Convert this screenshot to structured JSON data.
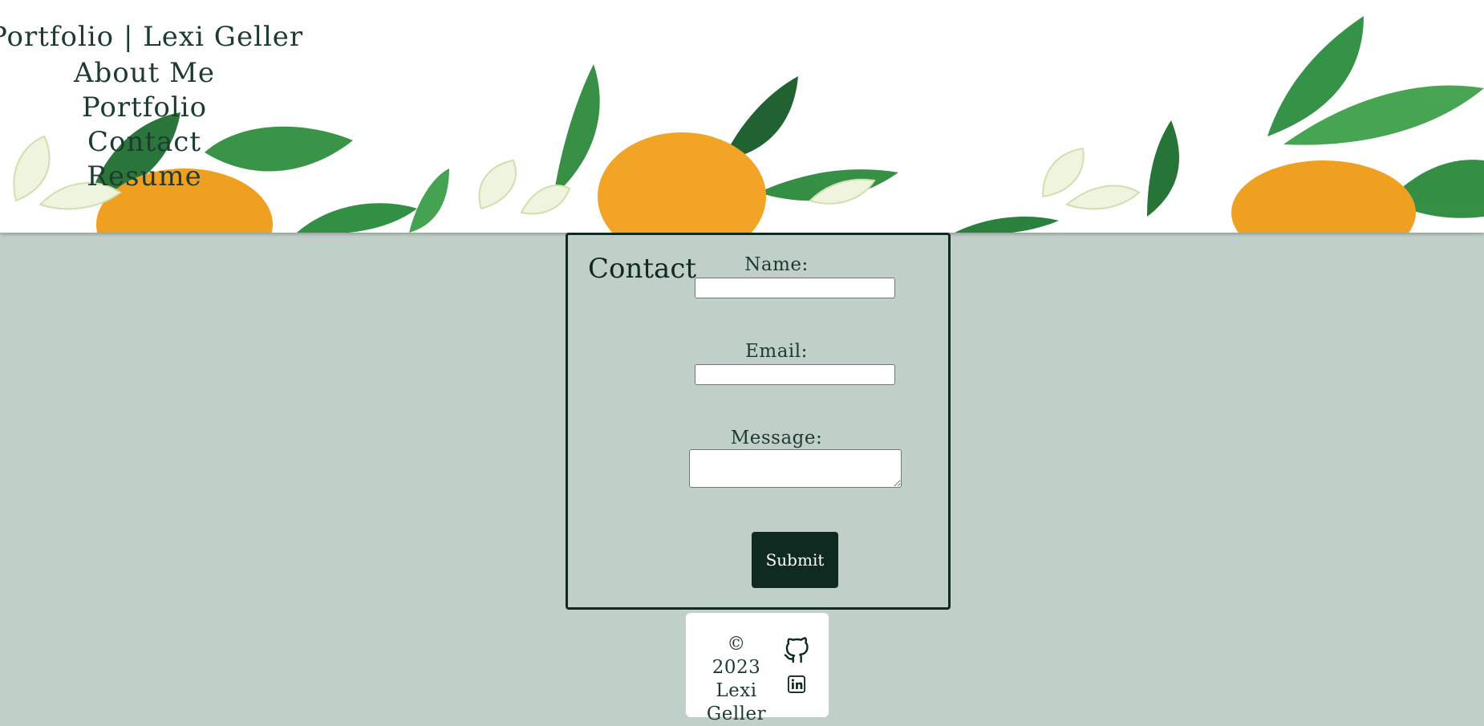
{
  "header": {
    "site_title": "Portfolio | Lexi Geller",
    "nav": [
      {
        "label": "About Me"
      },
      {
        "label": "Portfolio"
      },
      {
        "label": "Contact"
      },
      {
        "label": "Resume"
      }
    ],
    "banner_icon": "orange-blossom-banner"
  },
  "contact": {
    "heading": "Contact",
    "fields": {
      "name_label": "Name:",
      "name_value": "",
      "email_label": "Email:",
      "email_value": "",
      "message_label": "Message:",
      "message_value": ""
    },
    "submit_label": "Submit"
  },
  "footer": {
    "copyright": "© 2023 Lexi Geller",
    "icons": [
      "github-icon",
      "linkedin-icon"
    ]
  },
  "colors": {
    "page_background": "#c1cfc9",
    "dark_green": "#0f2a20",
    "text_green": "#1d3b31",
    "leaf_green": "#2e8b3e",
    "orange": "#f0a020"
  }
}
